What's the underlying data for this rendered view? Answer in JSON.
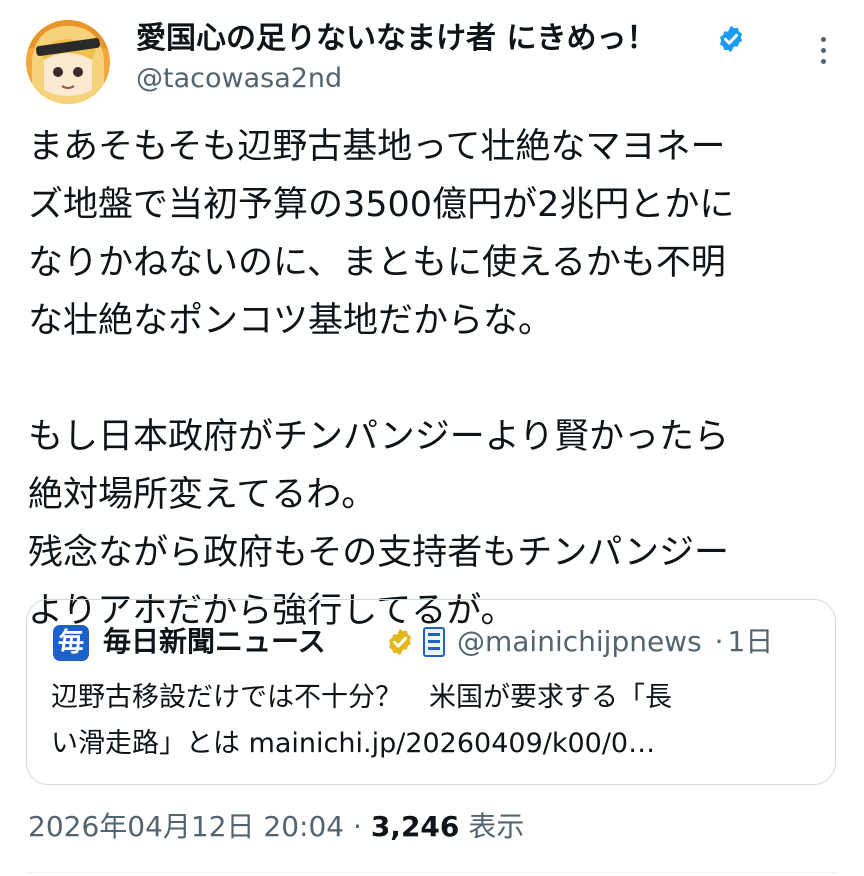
{
  "author": {
    "display_name": "愛国心の足りないなまけ者 にきめっ！",
    "handle": "@tacowasa2nd"
  },
  "tweet": {
    "lines": [
      "まあそもそも辺野古基地って壮絶なマヨネー",
      "ズ地盤で当初予算の3500億円が2兆円とかに",
      "なりかねないのに、まともに使えるかも不明",
      "な壮絶なポンコツ基地だからな。",
      "",
      "もし日本政府がチンパンジーより賢かったら",
      "絶対場所変えてるわ。",
      "残念ながら政府もその支持者もチンパンジー",
      "よりアホだから強行してるが。"
    ]
  },
  "quote": {
    "logo_glyph": "毎",
    "name": "毎日新聞ニュース",
    "handle": "@mainichijpnews",
    "separator": "·",
    "time": "1日",
    "text_lines": [
      "辺野古移設だけでは不十分？　米国が要求する「長",
      "い滑走路」とは mainichi.jp/20260409/k00/0…"
    ]
  },
  "meta": {
    "timestamp": "2026年04月12日 20:04",
    "separator": "·",
    "views_count": "3,246",
    "views_label": "表示"
  },
  "colors": {
    "text": "#0f1419",
    "secondary": "#536471",
    "verified_blue": "#1d9bf0",
    "verified_gold": "#e2b719",
    "border": "#cfd9de"
  },
  "icons": {
    "verified": "blue-check-badge-icon",
    "gold_verified": "gold-check-badge-icon",
    "org_affiliate": "newspaper-affiliate-icon",
    "more": "more-vertical-icon"
  }
}
